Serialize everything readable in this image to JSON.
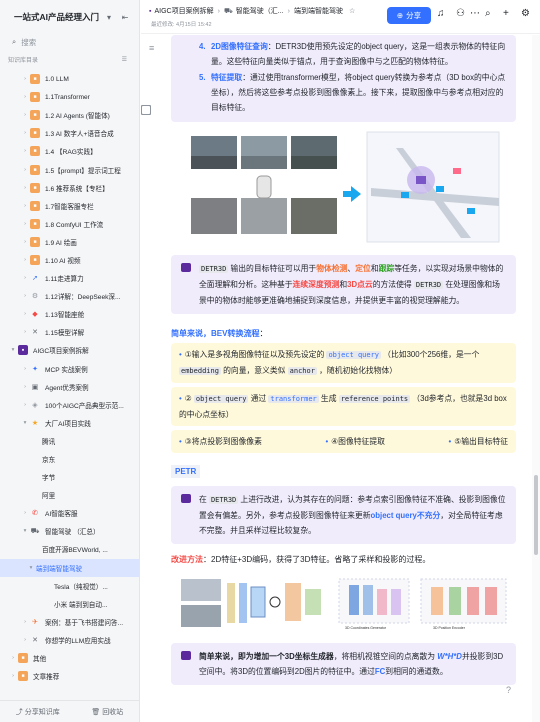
{
  "sidebar": {
    "title": "一站式AI产品经理入门...",
    "search_placeholder": "搜索",
    "section_label": "知识库目录",
    "items": [
      {
        "label": "1.0 LLM"
      },
      {
        "label": "1.1Transformer"
      },
      {
        "label": "1.2 AI Agents (智能体)"
      },
      {
        "label": "1.3 AI 数字人+语音合成"
      },
      {
        "label": "1.4 【RAG实践】"
      },
      {
        "label": "1.5【prompt】提示词工程"
      },
      {
        "label": "1.6 推荐系统【专栏】"
      },
      {
        "label": "1.7智能客服专栏"
      },
      {
        "label": "1.8 ComfyUI 工作流"
      },
      {
        "label": "1.9 AI 绘画"
      },
      {
        "label": "1.10 AI 视频"
      },
      {
        "label": "1.11走进算力"
      },
      {
        "label": "1.12详解：DeepSeek深..."
      },
      {
        "label": "1.13智能座舱"
      },
      {
        "label": "1.15模型详解"
      },
      {
        "label": "AIGC项目案例拆解"
      },
      {
        "label": "MCP 实战案例"
      },
      {
        "label": "Agent优秀案例"
      },
      {
        "label": "100个AIGC产品典型示范..."
      },
      {
        "label": "大厂AI项目实践"
      },
      {
        "label": "腾讯"
      },
      {
        "label": "京东"
      },
      {
        "label": "字节"
      },
      {
        "label": "阿里"
      },
      {
        "label": "AI智能客服"
      },
      {
        "label": "智能驾驶 （汇总）"
      },
      {
        "label": "百度开源BEVWorld, ..."
      },
      {
        "label": "端到端智能驾驶"
      },
      {
        "label": "Tesla（纯视觉）..."
      },
      {
        "label": "小米 端到到自动..."
      },
      {
        "label": "案例：基于飞书搭建问答..."
      },
      {
        "label": "你想学的LLM应用实战"
      },
      {
        "label": "其他"
      },
      {
        "label": "文章推荐"
      }
    ],
    "share_label": "分享知识库",
    "recycle_label": "回收站"
  },
  "topbar": {
    "crumbs": [
      "AIGC项目案例拆解",
      "智能驾驶（汇...",
      "端到端智能驾驶"
    ],
    "edited": "最近修改: 4月15日 15:42",
    "share_label": "分享"
  },
  "doc": {
    "list": [
      {
        "num": "4.",
        "title": "2D图像特征查询",
        "text": "：DETR3D使用预先设定的object query，这是一组表示物体的特征向量。这些特征向量类似于锚点，用于查询图像中与之匹配的物体特征。"
      },
      {
        "num": "5.",
        "title": "特征提取",
        "text": "：通过使用transformer模型，将object query转换为参考点（3D box的中心点坐标），然后将这些参考点投影到图像像素上。接下来，提取图像中与参考点相对应的目标特征。"
      }
    ],
    "callout1": {
      "code1": "DETR3D",
      "t1": " 输出的目标特征可以用于",
      "k1": "物体检测",
      "t2": "、",
      "k2": "定位",
      "t3": "和",
      "k3": "跟踪",
      "t4": "等任务，以实现对场景中物体的全面理解和分析。这种基于",
      "k4": "连续深度预测",
      "t5": "和",
      "k5": "3D点云",
      "t6": "的方法使得 ",
      "code2": "DETR3D",
      "t7": " 在处理图像和场景中的物体时能够更准确地捕捉到深度信息，并提供更丰富的视觉理解能力。"
    },
    "simple_heading": "简单来说，BEV转换流程",
    "colon": "：",
    "y1": {
      "t1": "①输入是多视角图像特征以及预先设定的 ",
      "code1": "object query",
      "t2": " （比如300个256维，是一个 ",
      "code2": "embedding",
      "t3": " 的向量，意义类似 ",
      "code3": "anchor",
      "t4": " ，随机初始化找物体）"
    },
    "y2": {
      "t1": "② ",
      "code1": "object query",
      "t2": " 通过 ",
      "code2": "transformer",
      "t3": " 生成 ",
      "code3": "reference points",
      "t4": " （3d参考点，也就是3d box的中心点坐标）"
    },
    "y3": [
      "③将点投影到图像像素",
      "④图像特征提取",
      "⑤输出目标特征"
    ],
    "petr_label": "PETR",
    "callout2": {
      "t1": "在 ",
      "code1": "DETR3D",
      "t2": " 上进行改进，认为其存在的问题：参考点索引图像特征不准确、投影到图像位置会有偏差。另外，参考点投影到图像特征来更新",
      "k1": "object query不充分",
      "t3": "，对全局特征考虑不完整。并且采样过程比较复杂。"
    },
    "improve_label": "改进方法",
    "improve_text": "：2D特征+3D编码，获得了3D特征。省略了采样和投影的过程。",
    "callout3": {
      "k1": "简单来说，即为增加一个3D坐标生成器",
      "t1": "，将相机视锥空间的点离散为 ",
      "k2": "W*H*D",
      "t2": "并投影到3D空间中。将3D的位置编码到2D图片的特征中。通过",
      "k3": "FC",
      "t3": "到相同的通道数。"
    },
    "fig2_labels": [
      "3D Coordinates Generator",
      "3D Position Encoder"
    ]
  },
  "colors": {
    "accent": "#3370ff",
    "callout_bg": "#f0ecfc",
    "yellow_bg": "#fff9db",
    "active_bg": "#dbe4ff"
  }
}
